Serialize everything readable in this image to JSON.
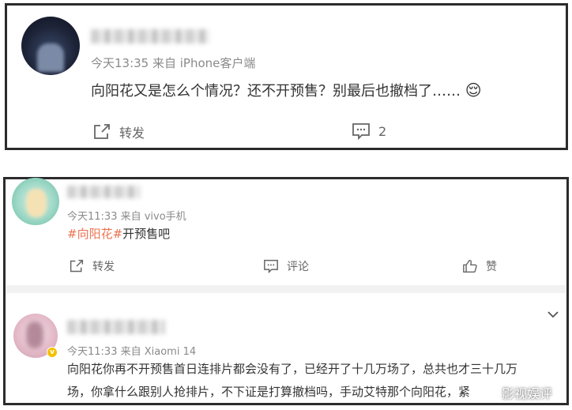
{
  "post1": {
    "meta": "今天13:35  来自 iPhone客户端",
    "text": "向阳花又是怎么个情况？还不开预售？别最后也撤档了……",
    "emoji": "😌",
    "repost_label": "转发",
    "comment_count": "2"
  },
  "comment1": {
    "meta": "今天11:33  来自 vivo手机",
    "hashtag": "#向阳花#",
    "text": "开预售吧",
    "repost_label": "转发",
    "comment_label": "评论",
    "like_label": "赞"
  },
  "comment2": {
    "meta": "今天11:33  来自 Xiaomi 14",
    "badge": "v",
    "text_line1": "向阳花你再不开预售首日连排片都会没有了，已经开了十几万场了，总共也才三十几万",
    "text_line2": "场，你拿什么跟别人抢排片，不下证是打算撤档吗，手动艾特那个向阳花，紧",
    "watermark": "影视娱评"
  }
}
